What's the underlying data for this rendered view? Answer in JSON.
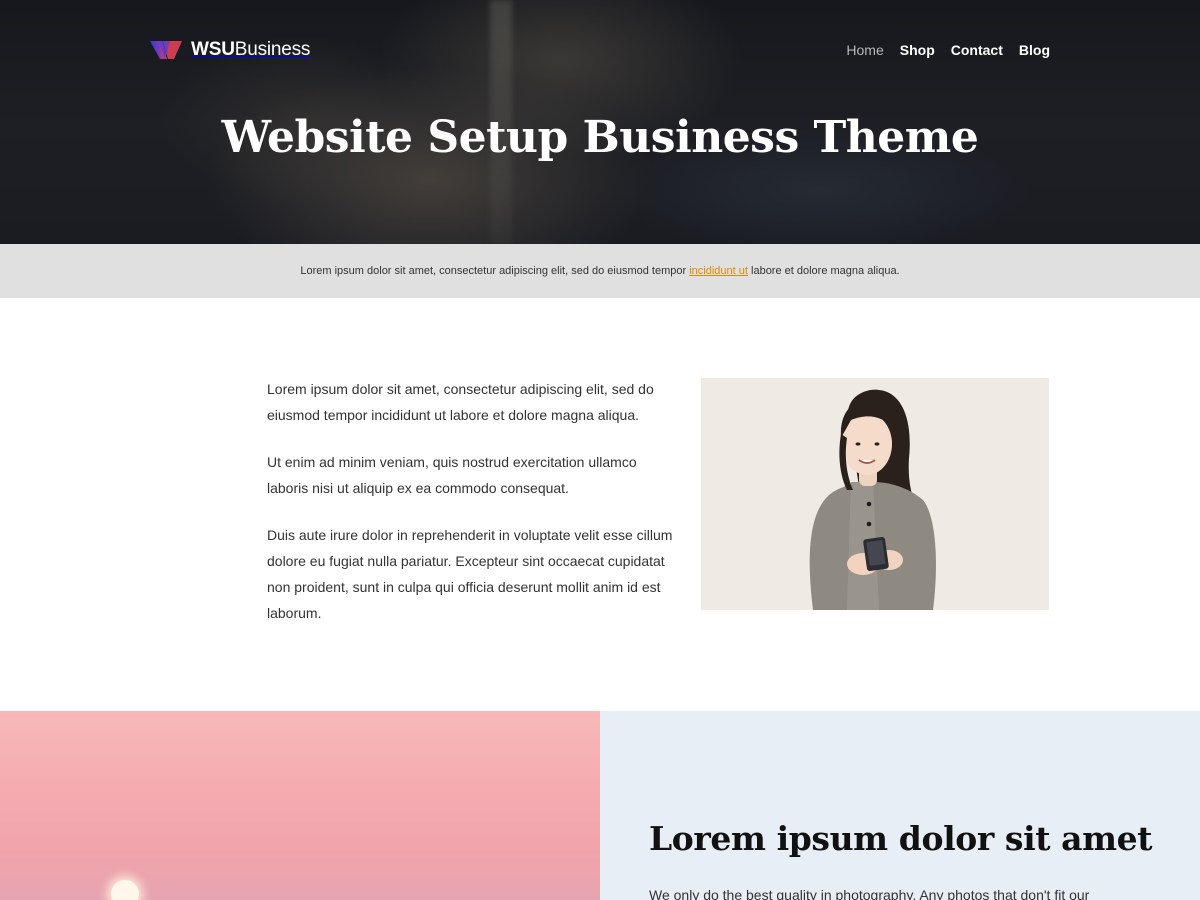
{
  "brand": {
    "name_bold": "WSU",
    "name_light": "Business",
    "colors": {
      "mark_left": "#2f3bd1",
      "mark_right": "#e0415a"
    }
  },
  "nav": {
    "items": [
      {
        "label": "Home",
        "active": true
      },
      {
        "label": "Shop",
        "active": false
      },
      {
        "label": "Contact",
        "active": false
      },
      {
        "label": "Blog",
        "active": false
      }
    ]
  },
  "hero": {
    "title": "Website Setup Business Theme"
  },
  "notice": {
    "text_before": "Lorem ipsum dolor sit amet, consectetur adipiscing elit, sed do eiusmod tempor ",
    "link": "incididunt ut",
    "text_after": " labore et dolore magna aliqua.",
    "link_color": "#e08a00"
  },
  "content": {
    "paragraphs": [
      "Lorem ipsum dolor sit amet, consectetur adipiscing elit, sed do eiusmod tempor incididunt ut labore et dolore magna aliqua.",
      "Ut enim ad minim veniam, quis nostrud exercitation ullamco laboris nisi ut aliquip ex ea commodo consequat.",
      "Duis aute irure dolor in reprehenderit in voluptate velit esse cillum dolore eu fugiat nulla pariatur. Excepteur sint occaecat cupidatat non proident, sunt in culpa qui officia deserunt mollit anim id est laborum."
    ]
  },
  "feature": {
    "title": "Lorem ipsum dolor sit amet",
    "text": "We only do the best quality in photography. Any photos that don't fit our"
  }
}
